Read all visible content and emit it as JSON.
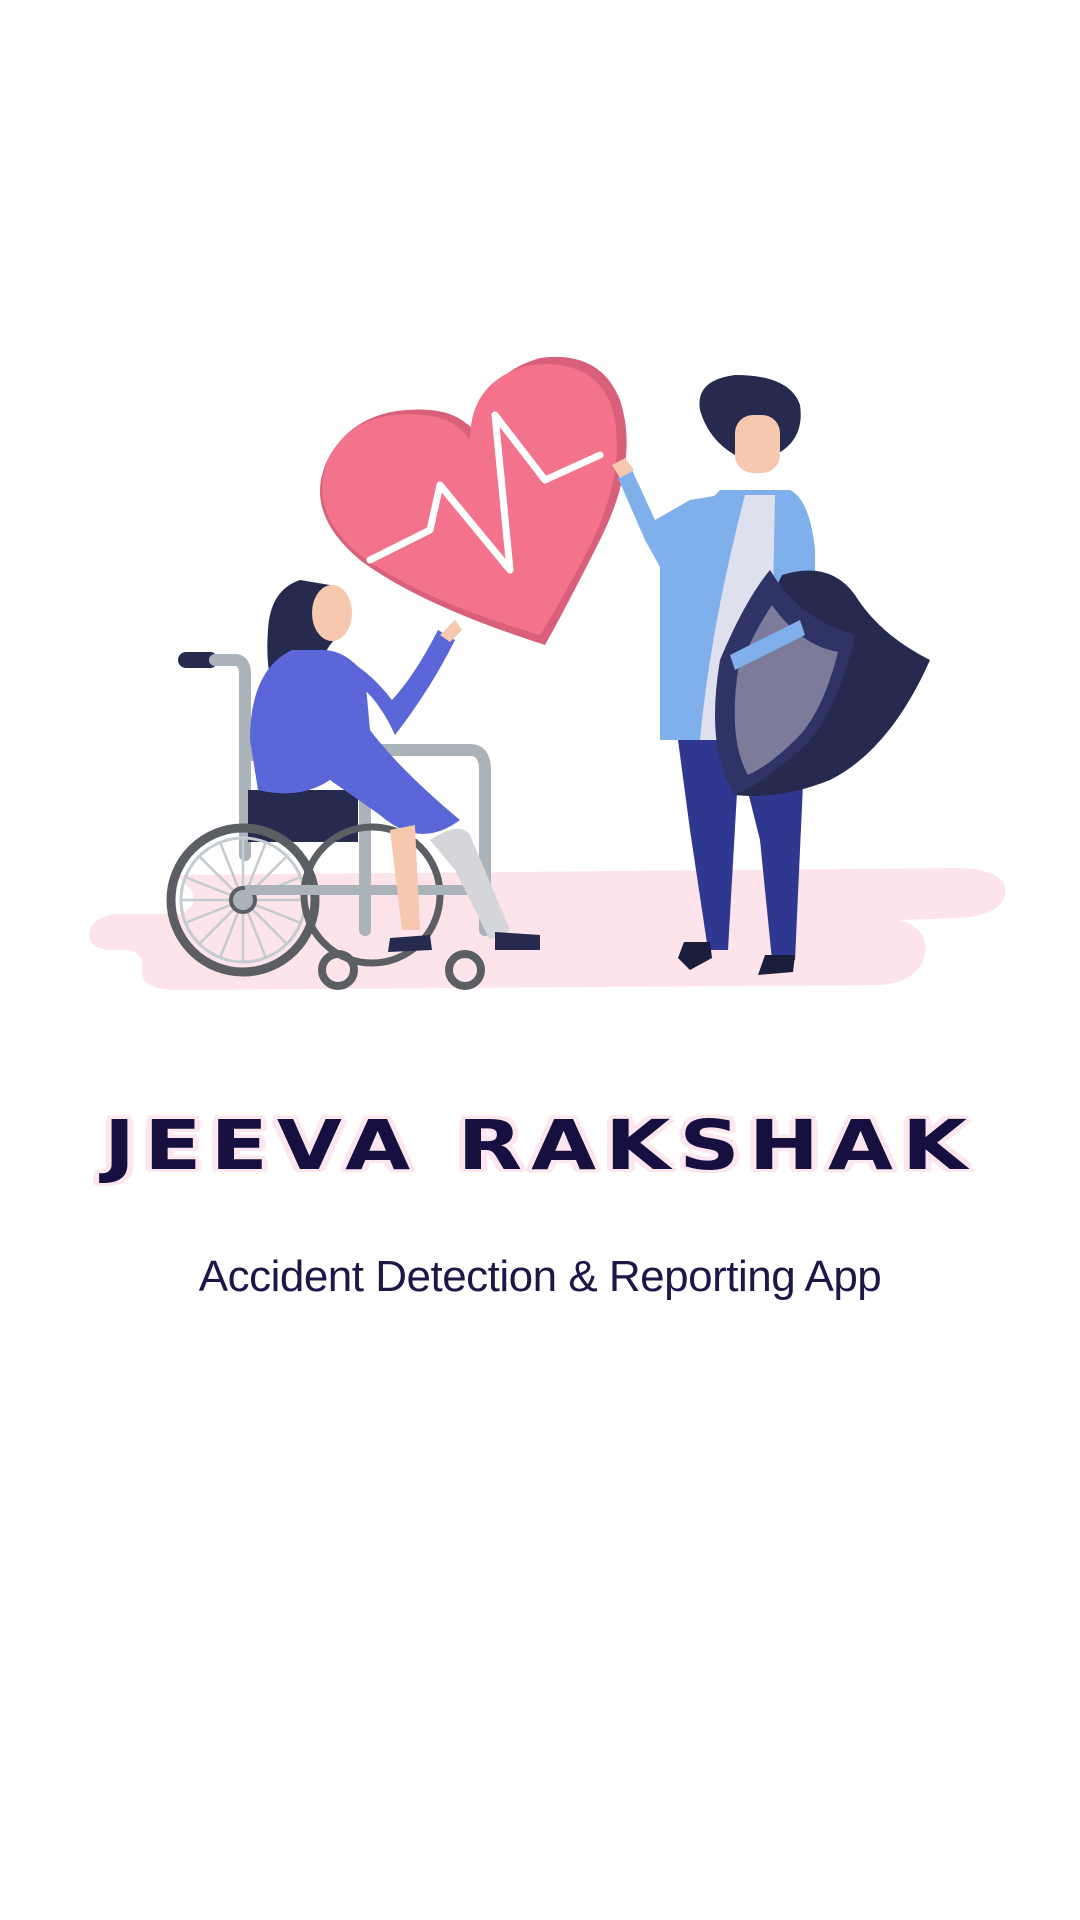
{
  "app": {
    "title": "JEEVA RAKSHAK",
    "subtitle": "Accident Detection & Reporting App"
  },
  "illustration": {
    "icons": [
      "heart-pulse-icon",
      "wheelchair-icon",
      "shield-icon"
    ]
  },
  "colors": {
    "background": "#ffffff",
    "title": "#160f3f",
    "title_glow": "#fde6ee",
    "subtitle": "#1d1749",
    "heart": "#f2738b",
    "ground": "#fde4ea",
    "navy": "#262a4f"
  }
}
